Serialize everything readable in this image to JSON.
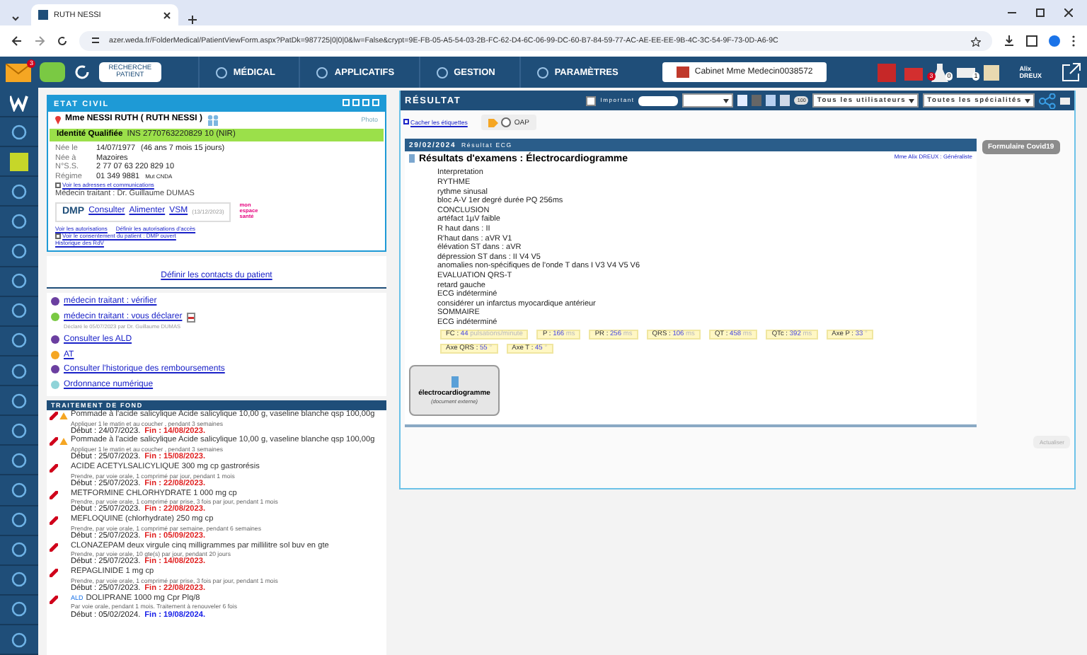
{
  "browser": {
    "tab_title": "RUTH NESSI",
    "url": "azer.weda.fr/FolderMedical/PatientViewForm.aspx?PatDk=987725|0|0|0&lw=False&crypt=9E-FB-05-A5-54-03-2B-FC-62-D4-6C-06-99-DC-60-B7-84-59-77-AC-AE-EE-EE-9B-4C-3C-54-9F-73-0D-A6-9C"
  },
  "nav": {
    "mail_badge": "3",
    "search_label": "RECHERCHE PATIENT",
    "menus": [
      "MÉDICAL",
      "APPLICATIFS",
      "GESTION",
      "PARAMÈTRES"
    ],
    "cabinet": "Cabinet Mme Medecin0038572",
    "lab_badges": [
      "3",
      "0"
    ],
    "print_badge": "1",
    "user": "Alix DREUX"
  },
  "etat_civil": {
    "title": "ETAT CIVIL",
    "name": "Mme NESSI RUTH ( RUTH NESSI )",
    "photo": "Photo",
    "identity_status": "Identité Qualifiée",
    "ins": "INS 2770763220829 10 (NIR)",
    "fields": [
      {
        "label": "Née le",
        "value": "14/07/1977",
        "extra": "(46 ans 7 mois 15 jours)"
      },
      {
        "label": "Née à",
        "value": "Mazoires"
      },
      {
        "label": "N°S.S.",
        "value": "2 77 07 63 220 829 10"
      },
      {
        "label": "Régime",
        "value": "01 349 9881",
        "extra": "Mut CNDA"
      }
    ],
    "addresses_link": "Voir les adresses et communications",
    "doctor": "Médecin traitant : Dr. Guillaume DUMAS",
    "dmp": {
      "label": "DMP",
      "links": [
        "Consulter",
        "Alimenter",
        "VSM"
      ],
      "date": "(13/12/2023)",
      "logo": "mon espace santé"
    },
    "links": [
      "Voir les autorisations",
      "Définir les autorisations d'accès",
      "Voir le consentement du patient : DMP ouvert",
      "Historique des RdV"
    ]
  },
  "contacts_link": "Définir les contacts du patient",
  "alerts": [
    {
      "label": "médecin traitant : vérifier",
      "color": "#6b3fa0"
    },
    {
      "label": "médecin traitant : vous déclarer",
      "note": "Déclaré le 05/07/2023 par Dr. Guillaume DUMAS",
      "color": "#7ac943",
      "pdf": true
    },
    {
      "label": "Consulter les ALD",
      "color": "#6b3fa0"
    },
    {
      "label": "AT",
      "color": "#f5a623"
    },
    {
      "label": "Consulter l'historique des remboursements",
      "color": "#6b3fa0"
    },
    {
      "label": "Ordonnance numérique",
      "color": "#8fd3d8"
    }
  ],
  "treatments": {
    "title": "TRAITEMENT DE FOND",
    "items": [
      {
        "name": "Pommade à l'acide salicylique Acide salicylique 10,00 g, vaseline blanche qsp 100,00g",
        "warning": true,
        "ald": false,
        "instructions": "Appliquer 1 le matin et au coucher , pendant 3 semaines",
        "start": "Début : 24/07/2023.",
        "end": "Fin : 14/08/2023.",
        "expired": true
      },
      {
        "name": "Pommade à l'acide salicylique Acide salicylique 10,00 g, vaseline blanche qsp 100,00g",
        "warning": true,
        "ald": false,
        "instructions": "Appliquer 1 le matin et au coucher , pendant 3 semaines",
        "start": "Début : 25/07/2023.",
        "end": "Fin : 15/08/2023.",
        "expired": true
      },
      {
        "name": "ACIDE ACETYLSALICYLIQUE 300 mg cp gastrorésis",
        "warning": false,
        "ald": false,
        "instructions": "Prendre, par voie orale, 1 comprimé par jour, pendant 1 mois",
        "start": "Début : 25/07/2023.",
        "end": "Fin : 22/08/2023.",
        "expired": true
      },
      {
        "name": "METFORMINE CHLORHYDRATE 1 000 mg cp",
        "warning": false,
        "ald": false,
        "instructions": "Prendre, par voie orale, 1 comprimé par prise, 3 fois par jour, pendant 1 mois",
        "start": "Début : 25/07/2023.",
        "end": "Fin : 22/08/2023.",
        "expired": true
      },
      {
        "name": "MEFLOQUINE (chlorhydrate) 250 mg cp",
        "warning": false,
        "ald": false,
        "instructions": "Prendre, par voie orale, 1 comprimé par semaine, pendant 6 semaines",
        "start": "Début : 25/07/2023.",
        "end": "Fin : 05/09/2023.",
        "expired": true
      },
      {
        "name": "CLONAZEPAM deux virgule cinq milligrammes par millilitre sol buv en gte",
        "warning": false,
        "ald": false,
        "instructions": "Prendre, par voie orale, 10 gte(s) par jour, pendant 20 jours",
        "start": "Début : 25/07/2023.",
        "end": "Fin : 14/08/2023.",
        "expired": true
      },
      {
        "name": "REPAGLINIDE 1 mg cp",
        "warning": false,
        "ald": false,
        "instructions": "Prendre, par voie orale, 1 comprimé par prise, 3 fois par jour, pendant 1 mois",
        "start": "Début : 25/07/2023.",
        "end": "Fin : 22/08/2023.",
        "expired": true
      },
      {
        "name": "DOLIPRANE 1000 mg Cpr Plq/8",
        "warning": false,
        "ald": true,
        "ald_label": "ALD",
        "instructions": "Par voie orale, pendant 1 mois. Traitement à renouveler 6 fois",
        "start": "Début : 05/02/2024.",
        "end": "Fin : 19/08/2024.",
        "expired": false
      }
    ]
  },
  "result": {
    "title": "RÉSULTAT",
    "important": {
      "label": "Important",
      "checked": false
    },
    "user_filter": "Tous les utilisateurs",
    "specialty_filter": "Toutes les spécialités",
    "count_button": "100",
    "hide_labels_link": "Cacher les étiquettes",
    "oap": {
      "label": "OAP",
      "selected": false
    },
    "entry": {
      "date": "29/02/2024",
      "type": "Résultat ECG",
      "title": "Résultats d'examens : Électrocardiogramme",
      "author": "Mme Alix DREUX : Généraliste",
      "lines": [
        "Interpretation",
        "RYTHME",
        "rythme sinusal",
        "bloc A-V 1er degré durée PQ 256ms",
        "CONCLUSION",
        "artéfact 1µV faible",
        "R haut dans : II",
        "R'haut dans : aVR V1",
        "élévation ST dans : aVR",
        "dépression ST dans : II V4 V5",
        "anomalies non-spécifiques de l'onde T dans I V3 V4 V5 V6",
        "EVALUATION QRS-T",
        "retard gauche",
        "ECG indéterminé",
        "considérer un infarctus myocardique antérieur",
        "SOMMAIRE",
        "ECG indéterminé"
      ],
      "measures": [
        {
          "label": "FC :",
          "value": "44",
          "unit": "pulsations/minute"
        },
        {
          "label": "P :",
          "value": "166",
          "unit": "ms"
        },
        {
          "label": "PR :",
          "value": "256",
          "unit": "ms"
        },
        {
          "label": "QRS :",
          "value": "106",
          "unit": "ms"
        },
        {
          "label": "QT :",
          "value": "458",
          "unit": "ms"
        },
        {
          "label": "QTc :",
          "value": "392",
          "unit": "ms"
        },
        {
          "label": "Axe P :",
          "value": "33",
          "unit": "°"
        },
        {
          "label": "Axe QRS :",
          "value": "55",
          "unit": "°"
        },
        {
          "label": "Axe T :",
          "value": "45",
          "unit": "°"
        }
      ],
      "attachment": {
        "name": "électrocardiogramme",
        "note": "(document externe)"
      }
    },
    "form_button": "Formulaire Covid19",
    "refresh": "Actualiser"
  }
}
